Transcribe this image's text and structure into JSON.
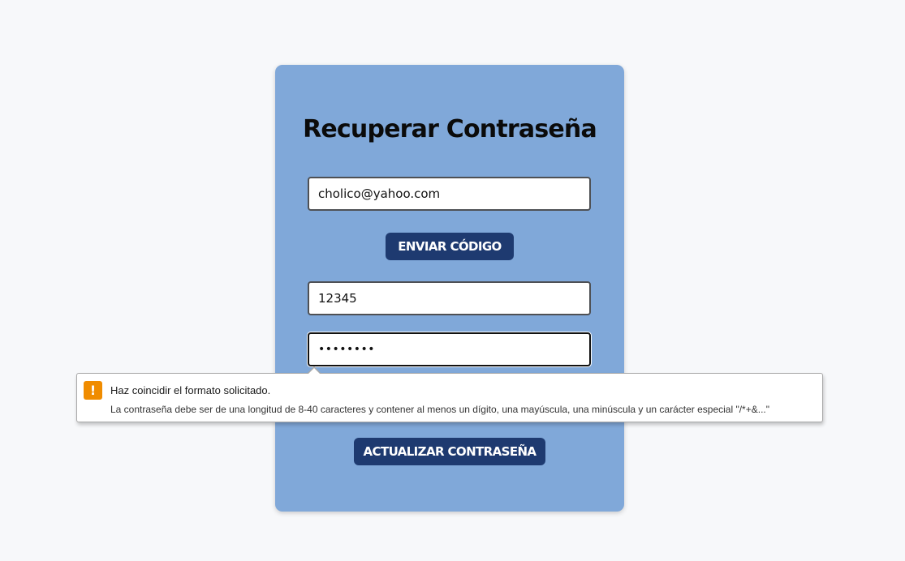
{
  "page": {
    "title": "Recuperar Contraseña"
  },
  "form": {
    "email_value": "cholico@yahoo.com",
    "send_code_label": "ENVIAR CÓDIGO",
    "code_value": "12345",
    "password_masked": "••••••••",
    "update_label": "ACTUALIZAR CONTRASEÑA"
  },
  "validation": {
    "icon": "warning-icon",
    "icon_glyph": "!",
    "title": "Haz coincidir el formato solicitado.",
    "message": "La contraseña debe ser de una longitud de 8-40 caracteres y contener al menos un dígito, una mayúscula, una minúscula y un carácter especial \"/*+&...\""
  },
  "colors": {
    "page_bg": "#f7f8fa",
    "card_bg": "#80a8d9",
    "button_bg": "#1e3a70",
    "warning": "#f08c00"
  }
}
